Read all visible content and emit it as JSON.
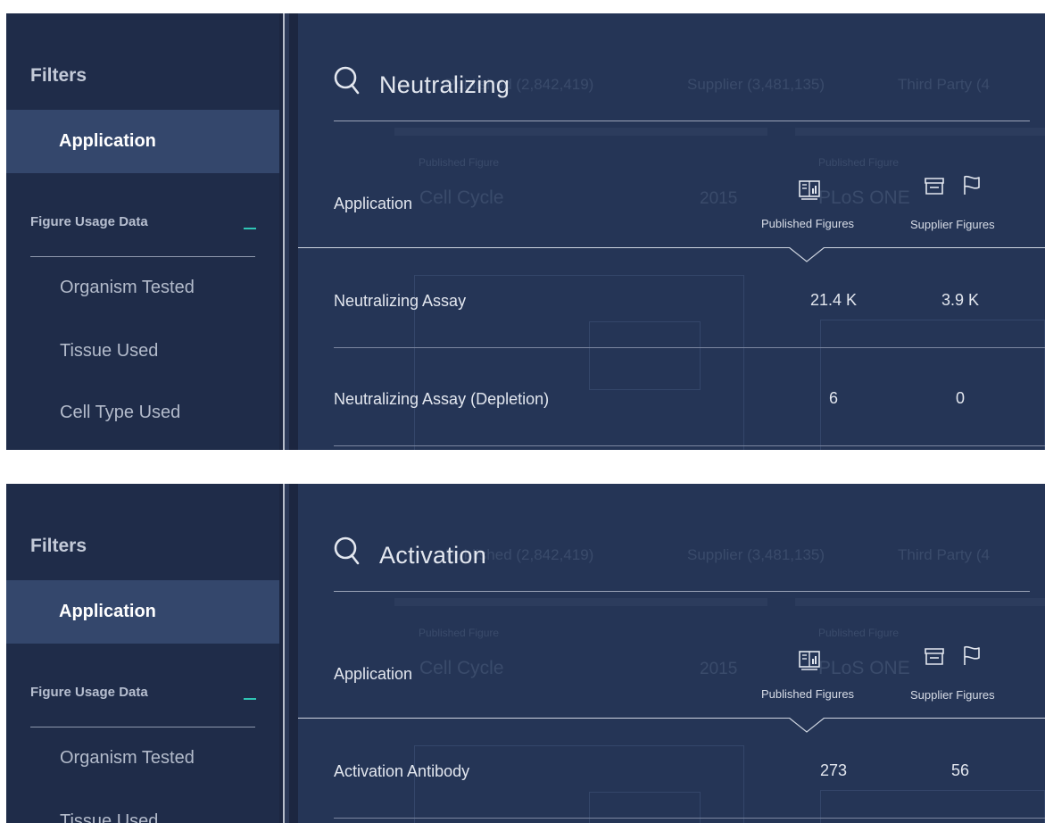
{
  "panels": [
    {
      "sidebar": {
        "title": "Filters",
        "active_item": "Application",
        "usage_header": "Figure Usage Data",
        "usage_toggle": "—",
        "items": [
          "Organism Tested",
          "Tissue Used",
          "Cell Type Used"
        ]
      },
      "search": {
        "query": "Neutralizing"
      },
      "table": {
        "column_application": "Application",
        "column_published": "Published Figures",
        "column_supplier": "Supplier Figures",
        "rows": [
          {
            "name": "Neutralizing Assay",
            "published": "21.4 K",
            "supplier": "3.9 K"
          },
          {
            "name": "Neutralizing Assay (Depletion)",
            "published": "6",
            "supplier": "0"
          }
        ]
      }
    },
    {
      "sidebar": {
        "title": "Filters",
        "active_item": "Application",
        "usage_header": "Figure Usage Data",
        "usage_toggle": "—",
        "items": [
          "Organism Tested",
          "Tissue Used"
        ]
      },
      "search": {
        "query": "Activation"
      },
      "table": {
        "column_application": "Application",
        "column_published": "Published Figures",
        "column_supplier": "Supplier Figures",
        "rows": [
          {
            "name": "Activation Antibody",
            "published": "273",
            "supplier": "56"
          }
        ]
      }
    }
  ],
  "background_ghost": {
    "published_filter": "Published (2,842,419)",
    "supplier_filter": "Supplier (3,481,135)",
    "third_party_filter": "Third Party (4",
    "card1_caption": "Published Figure",
    "card1_title": "Cell Cycle",
    "card1_year": "2015",
    "card2_caption": "Published Figure",
    "card2_journal": "PLoS ONE"
  },
  "colors": {
    "panel_bg": "#253556",
    "sidebar_bg": "#1f2c49",
    "active_item_bg": "#34476c",
    "accent_teal": "#2fc6b5"
  },
  "icons": [
    "search-icon",
    "published-figures-icon",
    "supplier-store-icon",
    "supplier-flag-icon"
  ]
}
